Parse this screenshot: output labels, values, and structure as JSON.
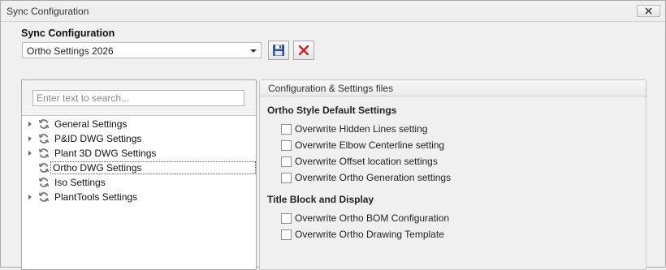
{
  "window": {
    "title": "Sync Configuration",
    "close_icon": "close-x-icon"
  },
  "config": {
    "heading": "Sync Configuration",
    "selected_value": "Ortho Settings 2026",
    "save_icon": "floppy-disk-icon",
    "delete_icon": "red-x-icon"
  },
  "search": {
    "placeholder": "Enter text to search..."
  },
  "tree": {
    "items": [
      {
        "label": "General Settings",
        "has_children": true,
        "icon": "sync-icon"
      },
      {
        "label": "P&ID DWG Settings",
        "has_children": true,
        "icon": "sync-icon"
      },
      {
        "label": "Plant 3D DWG Settings",
        "has_children": true,
        "icon": "sync-icon"
      },
      {
        "label": "Ortho DWG Settings",
        "has_children": false,
        "selected": true,
        "icon": "sync-icon"
      },
      {
        "label": "Iso Settings",
        "has_children": false,
        "icon": "sync-icon"
      },
      {
        "label": "PlantTools Settings",
        "has_children": true,
        "icon": "sync-icon"
      }
    ]
  },
  "settings_panel": {
    "header": "Configuration & Settings files",
    "groups": [
      {
        "title": "Ortho Style Default Settings",
        "options": [
          {
            "label": "Overwrite Hidden Lines setting",
            "checked": false
          },
          {
            "label": "Overwrite Elbow Centerline setting",
            "checked": false
          },
          {
            "label": "Overwrite Offset location settings",
            "checked": false
          },
          {
            "label": "Overwrite Ortho Generation settings",
            "checked": false
          }
        ]
      },
      {
        "title": "Title Block and Display",
        "options": [
          {
            "label": "Overwrite Ortho BOM Configuration",
            "checked": false
          },
          {
            "label": "Overwrite Ortho Drawing Template",
            "checked": false
          }
        ]
      }
    ]
  },
  "colors": {
    "accent_red": "#d71f1f",
    "save_blue": "#2a4fa8"
  }
}
